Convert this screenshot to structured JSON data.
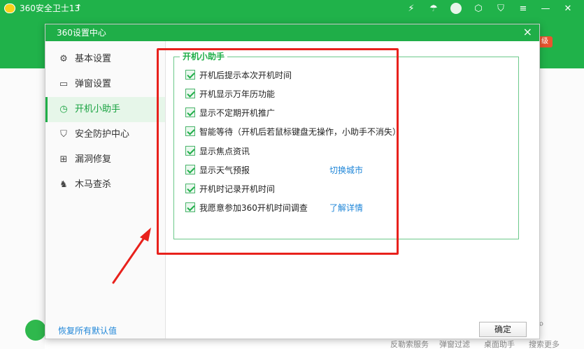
{
  "app": {
    "title": "360安全卫士13",
    "up_arrow": "↑",
    "badge": "级",
    "bottom_items": [
      "反勒索服务",
      "弹窗过滤",
      "桌面助手",
      "搜索更多"
    ]
  },
  "dialog": {
    "title": "360设置中心",
    "close_glyph": "×",
    "nav": [
      {
        "label": "基本设置",
        "icon": "gear-icon",
        "glyph": "⚙"
      },
      {
        "label": "弹窗设置",
        "icon": "window-icon",
        "glyph": "▭"
      },
      {
        "label": "开机小助手",
        "icon": "clock-icon",
        "glyph": "◷"
      },
      {
        "label": "安全防护中心",
        "icon": "shield-icon",
        "glyph": "⛉"
      },
      {
        "label": "漏洞修复",
        "icon": "patch-icon",
        "glyph": "⊞"
      },
      {
        "label": "木马查杀",
        "icon": "horse-icon",
        "glyph": "♞"
      }
    ],
    "active_nav_index": 2,
    "group_title": "开机小助手",
    "options": [
      {
        "label": "开机后提示本次开机时间",
        "checked": true
      },
      {
        "label": "开机显示万年历功能",
        "checked": true
      },
      {
        "label": "显示不定期开机推广",
        "checked": true
      },
      {
        "label": "智能等待（开机后若鼠标键盘无操作，小助手不消失）",
        "checked": true
      },
      {
        "label": "显示焦点资讯",
        "checked": true
      },
      {
        "label": "显示天气预报",
        "checked": true
      },
      {
        "label": "开机时记录开机时间",
        "checked": true
      },
      {
        "label": "我愿意参加360开机时间调查",
        "checked": true
      }
    ],
    "links": {
      "switch_city": "切换城市",
      "learn_more": "了解详情"
    },
    "footer": {
      "restore_defaults": "恢复所有默认值",
      "ok": "确定"
    }
  },
  "colors": {
    "brand_green": "#1fae48",
    "annotation_red": "#e8211c",
    "link_blue": "#1f86d8"
  }
}
